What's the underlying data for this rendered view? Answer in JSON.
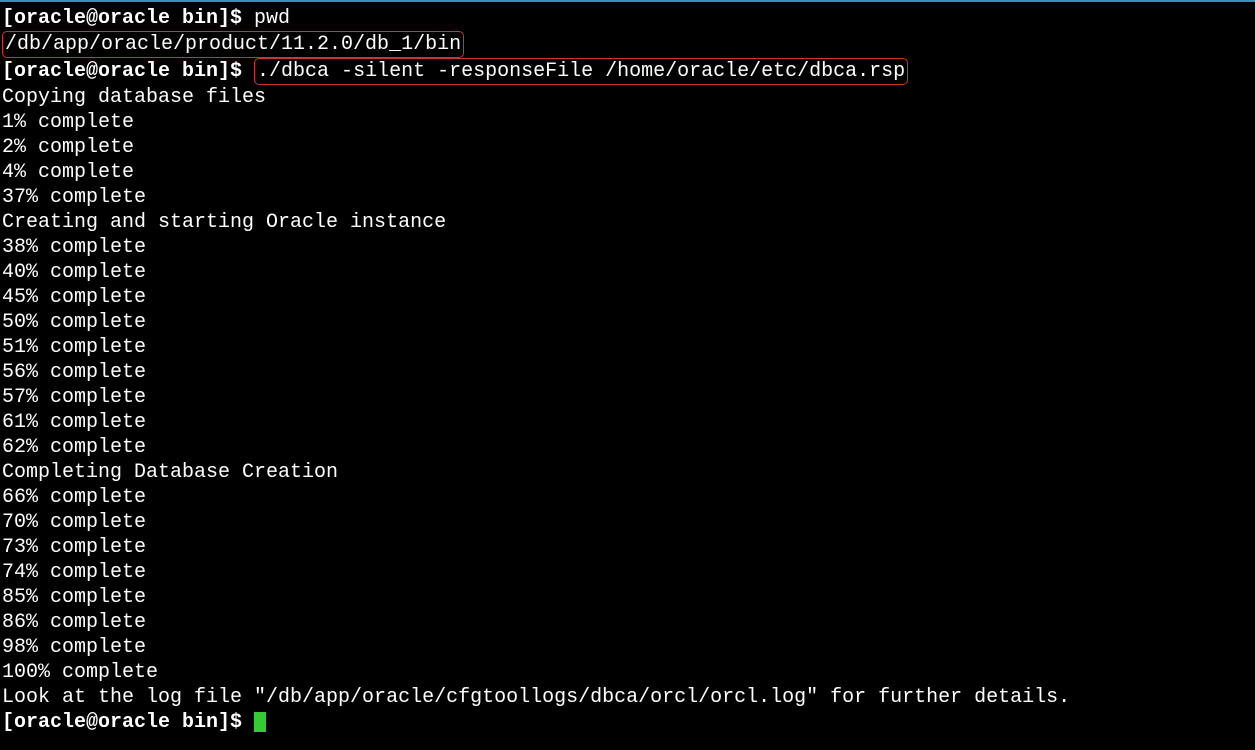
{
  "terminal": {
    "prompt1": "[oracle@oracle bin]$ ",
    "cmd1": "pwd",
    "output_path": "/db/app/oracle/product/11.2.0/db_1/bin",
    "prompt2": "[oracle@oracle bin]$ ",
    "cmd2": "./dbca -silent -responseFile /home/oracle/etc/dbca.rsp",
    "lines": [
      "Copying database files",
      "1% complete",
      "2% complete",
      "4% complete",
      "37% complete",
      "Creating and starting Oracle instance",
      "38% complete",
      "40% complete",
      "45% complete",
      "50% complete",
      "51% complete",
      "56% complete",
      "57% complete",
      "61% complete",
      "62% complete",
      "Completing Database Creation",
      "66% complete",
      "70% complete",
      "73% complete",
      "74% complete",
      "85% complete",
      "86% complete",
      "98% complete",
      "100% complete",
      "Look at the log file \"/db/app/oracle/cfgtoollogs/dbca/orcl/orcl.log\" for further details."
    ],
    "prompt3": "[oracle@oracle bin]$ "
  }
}
